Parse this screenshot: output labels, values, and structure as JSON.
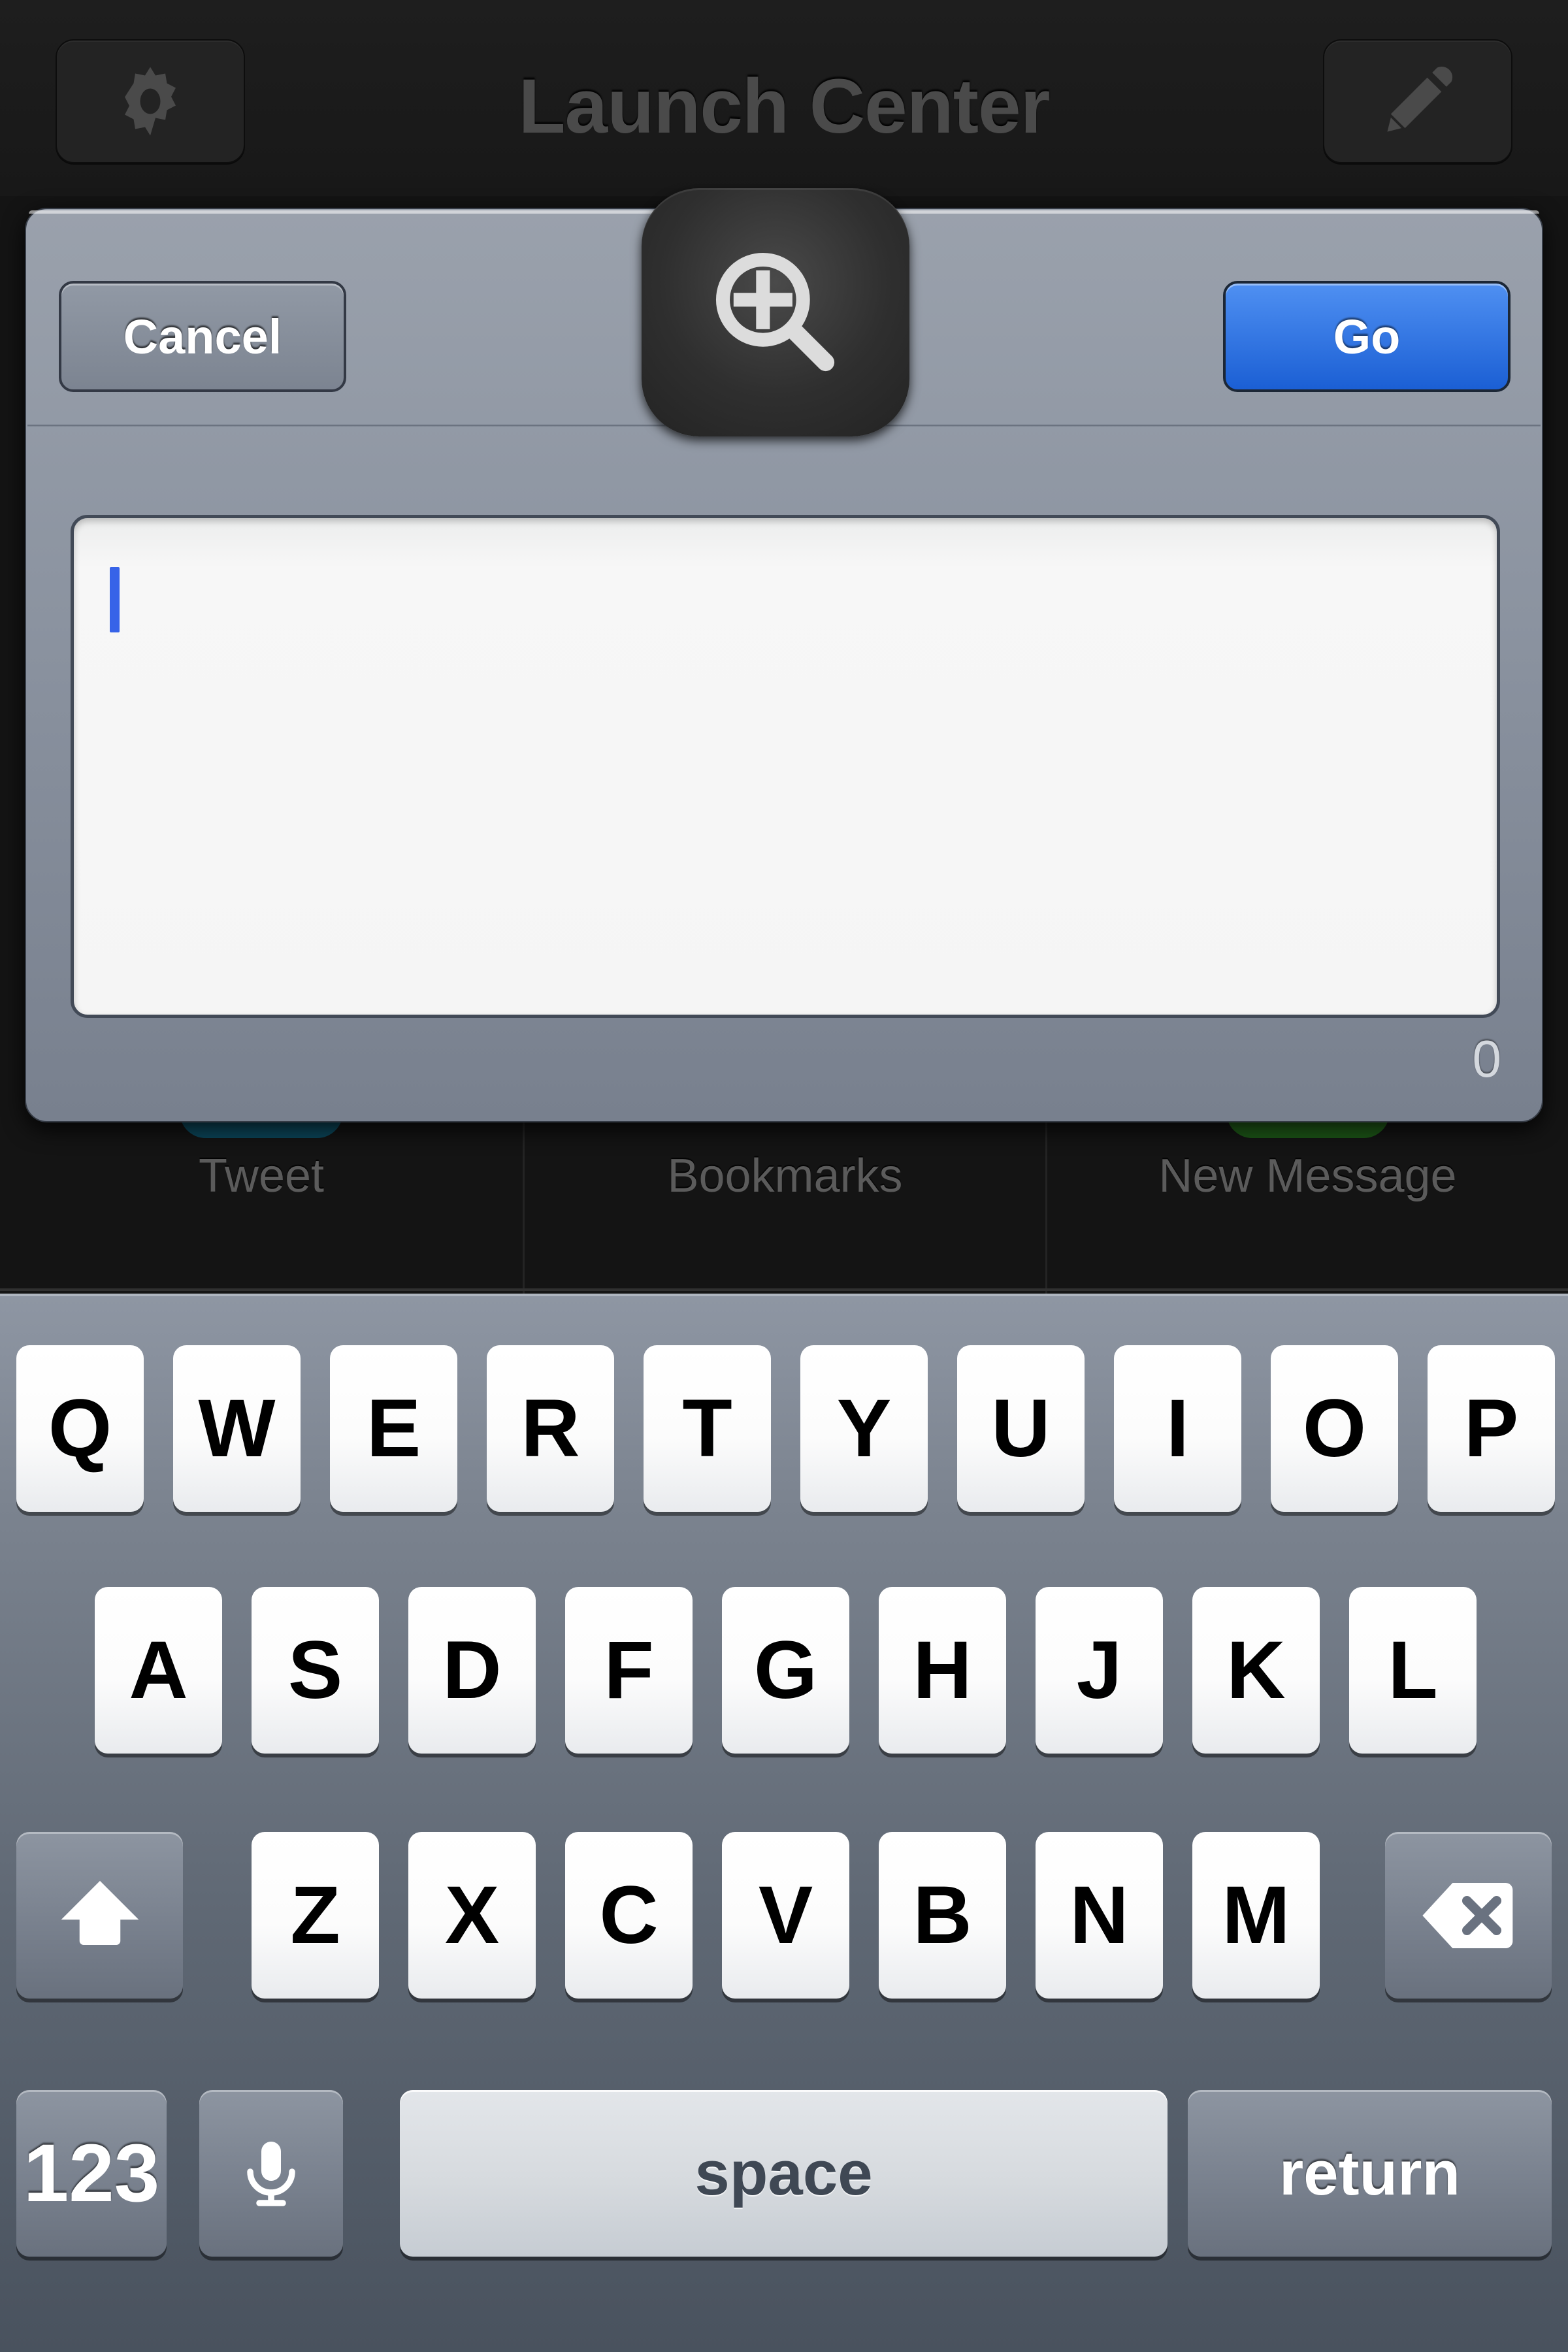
{
  "app": {
    "nav": {
      "title": "Launch Center",
      "settings_icon": "gear-icon",
      "edit_icon": "pencil-icon"
    },
    "grid": [
      {
        "label": "Tweet",
        "accent": "#0f5a72"
      },
      {
        "label": "Bookmarks",
        "accent": ""
      },
      {
        "label": "New Message",
        "accent": "#2d7a22"
      }
    ]
  },
  "dialog": {
    "icon": "magnifier-plus-icon",
    "cancel_label": "Cancel",
    "go_label": "Go",
    "input_value": "",
    "input_placeholder": "",
    "char_count": "0",
    "accent_color": "#2f79ec"
  },
  "keyboard": {
    "row1": [
      "Q",
      "W",
      "E",
      "R",
      "T",
      "Y",
      "U",
      "I",
      "O",
      "P"
    ],
    "row2": [
      "A",
      "S",
      "D",
      "F",
      "G",
      "H",
      "J",
      "K",
      "L"
    ],
    "row3": [
      "Z",
      "X",
      "C",
      "V",
      "B",
      "N",
      "M"
    ],
    "shift_icon": "shift-arrow-icon",
    "delete_icon": "backspace-icon",
    "numeric_label": "123",
    "mic_icon": "microphone-icon",
    "space_label": "space",
    "return_label": "return"
  }
}
